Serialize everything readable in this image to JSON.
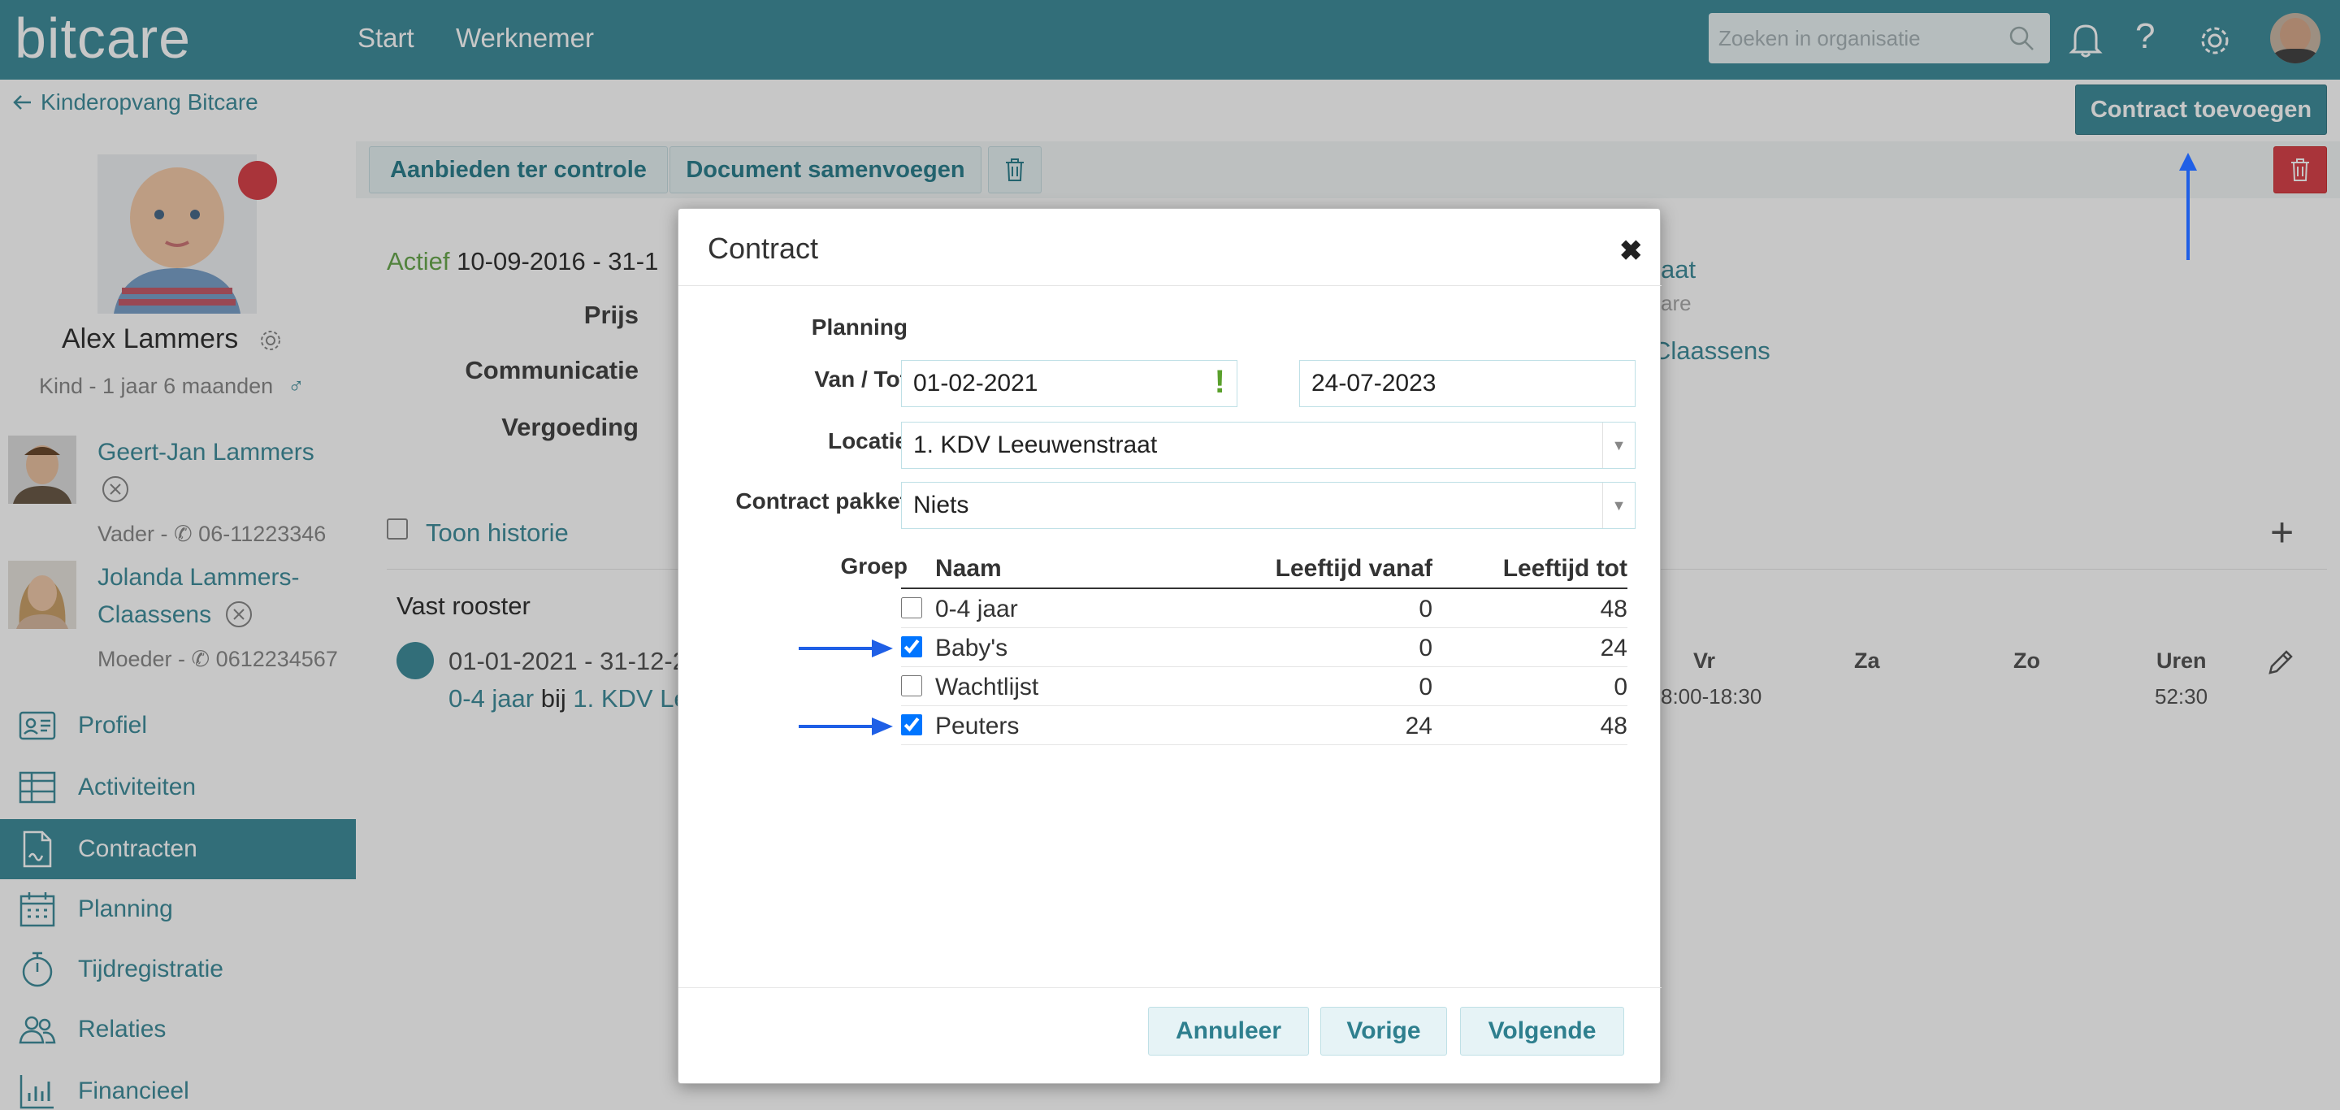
{
  "topbar": {
    "logo": "bitcare",
    "nav": [
      "Start",
      "Werknemer"
    ],
    "search_placeholder": "Zoeken in organisatie",
    "icons": [
      "search-icon",
      "bell-icon",
      "help-icon",
      "gear-icon",
      "user-avatar"
    ]
  },
  "sidebar": {
    "back_label": "Kinderopvang Bitcare",
    "child": {
      "name": "Alex Lammers",
      "subtitle": "Kind - 1 jaar 6 maanden",
      "gender_symbol": "♂",
      "status_color": "#d9434b"
    },
    "parents": [
      {
        "name": "Geert-Jan Lammers",
        "sub": "Vader - ",
        "phone": "06-11223346"
      },
      {
        "name_line1": "Jolanda Lammers-",
        "name_line2": "Claassens",
        "sub": "Moeder - ",
        "phone": "0612234567"
      }
    ],
    "menu": [
      {
        "label": "Profiel",
        "icon": "id-card-icon"
      },
      {
        "label": "Activiteiten",
        "icon": "table-icon"
      },
      {
        "label": "Contracten",
        "icon": "contract-icon",
        "active": true
      },
      {
        "label": "Planning",
        "icon": "calendar-icon"
      },
      {
        "label": "Tijdregistratie",
        "icon": "stopwatch-icon"
      },
      {
        "label": "Relaties",
        "icon": "people-icon"
      },
      {
        "label": "Financieel",
        "icon": "bar-chart-icon"
      }
    ]
  },
  "main": {
    "add_contract_label": "Contract toevoegen",
    "toolbar": {
      "offer_label": "Aanbieden ter controle",
      "merge_label": "Document samenvoegen"
    },
    "contract": {
      "status": "Actief",
      "period": "10-09-2016 - 31-1",
      "rows": [
        "Prijs",
        "Communicatie",
        "Vergoeding"
      ],
      "right_link": "aat",
      "right_sub": "are",
      "right_name": "Claassens"
    },
    "history_label": "Toon historie",
    "schedule": {
      "title": "Vast rooster",
      "period": "01-01-2021 - 31-12-2",
      "group": "0-4 jaar",
      "bij": "bij",
      "location": "1. KDV Le",
      "days": [
        "Vr",
        "Za",
        "Zo"
      ],
      "uren_label": "Uren",
      "vr_time": "8:00-18:30",
      "uren_value": "52:30"
    }
  },
  "modal": {
    "title": "Contract",
    "close": "✖",
    "section": "Planning",
    "van_tot_label": "Van / Tot",
    "from_date": "01-02-2021",
    "warning": "!",
    "to_date": "24-07-2023",
    "locatie_label": "Locatie",
    "locatie_value": "1. KDV Leeuwenstraat",
    "pakket_label": "Contract pakket",
    "pakket_value": "Niets",
    "groep_label": "Groep",
    "table": {
      "headers": [
        "Naam",
        "Leeftijd vanaf",
        "Leeftijd tot"
      ],
      "rows": [
        {
          "name": "0-4 jaar",
          "from": "0",
          "to": "48",
          "checked": false
        },
        {
          "name": "Baby's",
          "from": "0",
          "to": "24",
          "checked": true
        },
        {
          "name": "Wachtlijst",
          "from": "0",
          "to": "0",
          "checked": false
        },
        {
          "name": "Peuters",
          "from": "24",
          "to": "48",
          "checked": true
        }
      ]
    },
    "buttons": {
      "cancel": "Annuleer",
      "prev": "Vorige",
      "next": "Volgende"
    }
  },
  "colors": {
    "brand": "#418e9c",
    "danger": "#d9434b",
    "arrow": "#1f5fe6",
    "warning": "#5aa02c"
  }
}
